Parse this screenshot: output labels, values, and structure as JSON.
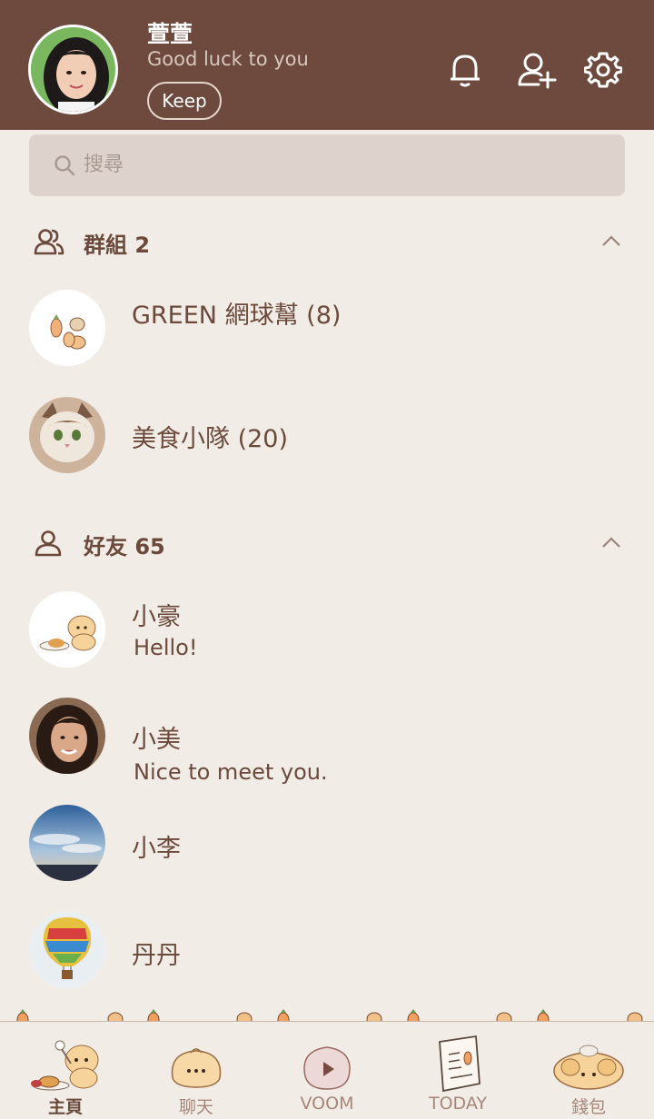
{
  "profile": {
    "name": "萱萱",
    "status": "Good luck to you",
    "keep_label": "Keep"
  },
  "header_icons": [
    "bell-icon",
    "add-friend-icon",
    "settings-icon"
  ],
  "search": {
    "placeholder": "搜尋"
  },
  "groups": {
    "title": "群組 2",
    "items": [
      {
        "name": "GREEN 網球幫 (8)"
      },
      {
        "name": "美食小隊 (20)"
      }
    ]
  },
  "friends": {
    "title": "好友 65",
    "items": [
      {
        "name": "小豪",
        "status": "Hello!"
      },
      {
        "name": "小美",
        "status": "Nice to meet you."
      },
      {
        "name": "小李",
        "status": ""
      },
      {
        "name": "丹丹",
        "status": ""
      }
    ]
  },
  "nav": [
    {
      "label": "主頁",
      "active": true
    },
    {
      "label": "聊天",
      "active": false
    },
    {
      "label": "VOOM",
      "active": false
    },
    {
      "label": "TODAY",
      "active": false
    },
    {
      "label": "錢包",
      "active": false
    }
  ],
  "colors": {
    "header_bg": "#6e4a3e",
    "page_bg": "#f2ece7",
    "text": "#6b4a3c",
    "search_bg": "#ded3cc"
  }
}
